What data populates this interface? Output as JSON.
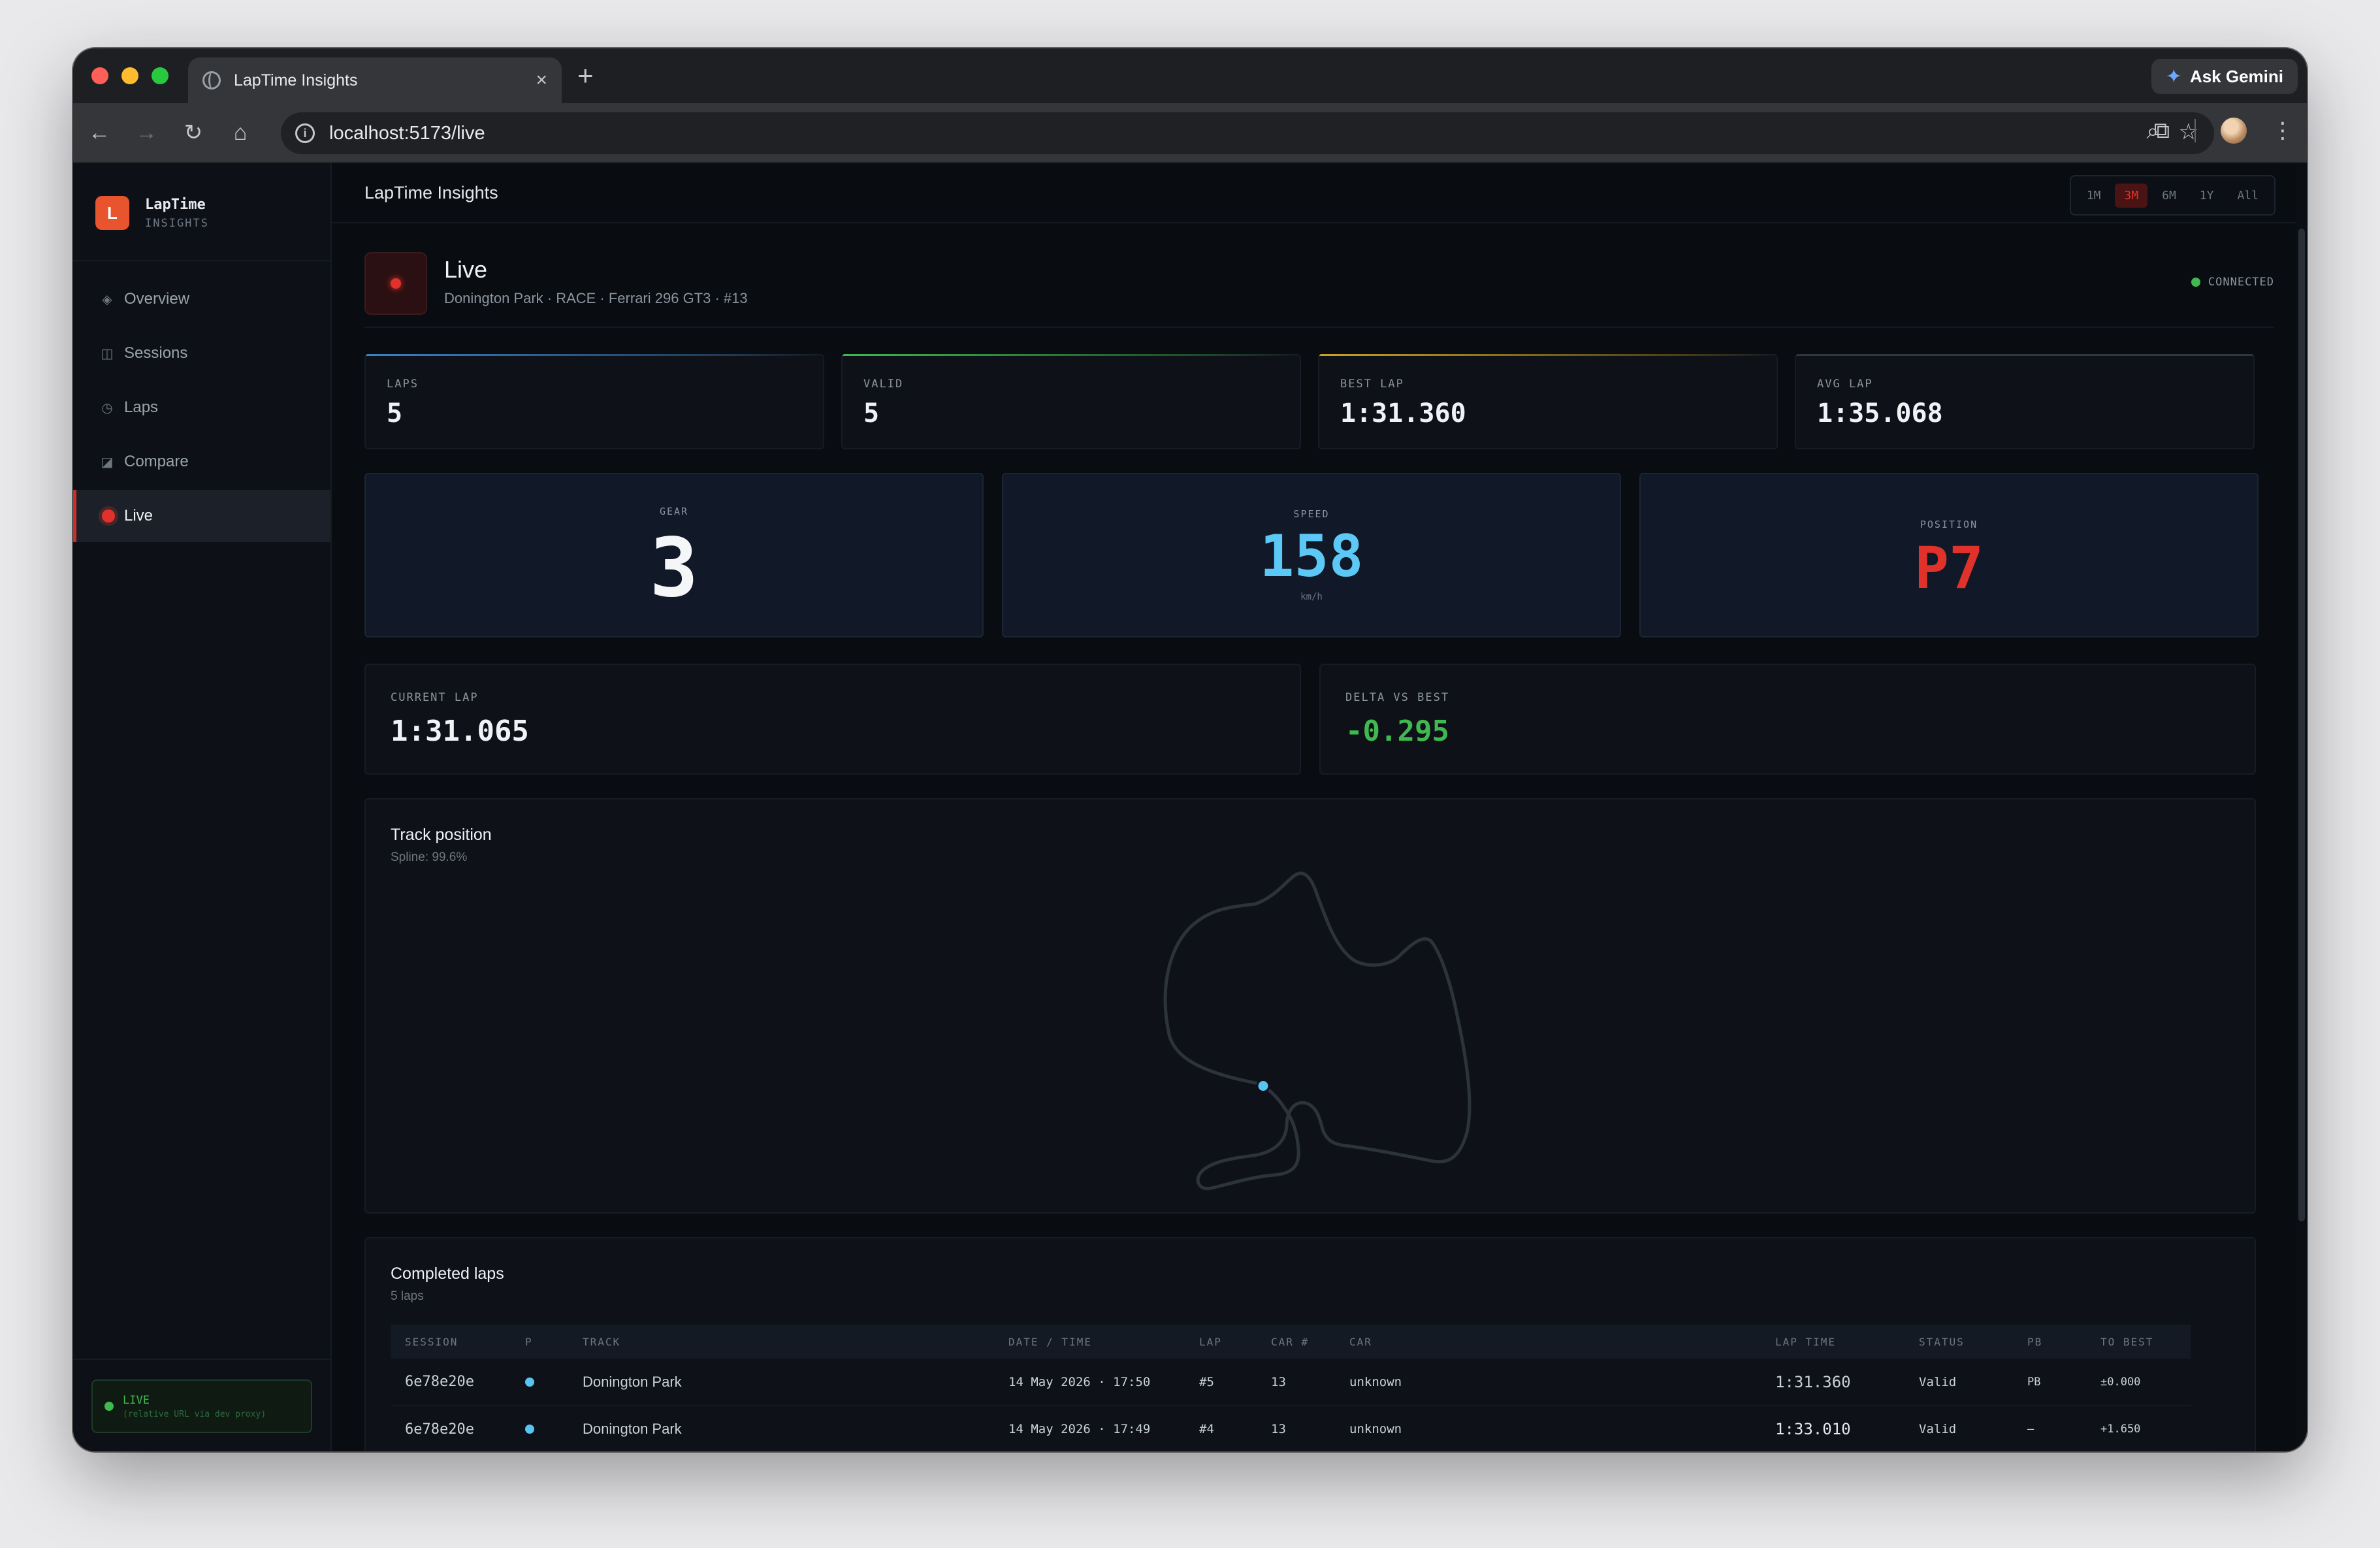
{
  "browser": {
    "tab_title": "LapTime Insights",
    "new_tab": "+",
    "ask_gemini": "Ask Gemini",
    "url": "localhost:5173/live"
  },
  "sidebar": {
    "brand_logo": "L",
    "brand_name": "LapTime",
    "brand_sub": "INSIGHTS",
    "items": [
      {
        "label": "Overview",
        "icon": "diamond-icon"
      },
      {
        "label": "Sessions",
        "icon": "columns-icon"
      },
      {
        "label": "Laps",
        "icon": "clock-icon"
      },
      {
        "label": "Compare",
        "icon": "chart-icon"
      },
      {
        "label": "Live",
        "icon": "live-dot-icon"
      }
    ],
    "live_status": "LIVE",
    "live_note": "(relative URL via dev proxy)"
  },
  "topbar": {
    "title": "LapTime Insights",
    "ranges": [
      "1M",
      "3M",
      "6M",
      "1Y",
      "All"
    ],
    "active_range": "3M"
  },
  "header": {
    "title": "Live",
    "subtitle": "Donington Park · RACE · Ferrari 296 GT3 · #13",
    "connection": "CONNECTED"
  },
  "stats": [
    {
      "label": "LAPS",
      "value": "5",
      "accent": "#3b82c4"
    },
    {
      "label": "VALID",
      "value": "5",
      "accent": "#3fb950"
    },
    {
      "label": "BEST LAP",
      "value": "1:31.360",
      "accent": "#c9a227"
    },
    {
      "label": "AVG LAP",
      "value": "1:35.068",
      "accent": "#30363d"
    }
  ],
  "telemetry": {
    "gear_label": "GEAR",
    "gear": "3",
    "speed_label": "SPEED",
    "speed": "158",
    "speed_unit": "km/h",
    "position_label": "POSITION",
    "position": "P7"
  },
  "timing": {
    "current_lap_label": "CURRENT LAP",
    "current_lap": "1:31.065",
    "delta_label": "DELTA VS BEST",
    "delta": "-0.295"
  },
  "track": {
    "title": "Track position",
    "spline": "Spline: 99.6%",
    "spline_fraction": 0.996
  },
  "laps_table": {
    "title": "Completed laps",
    "count": "5 laps",
    "columns": [
      "SESSION",
      "P",
      "TRACK",
      "DATE / TIME",
      "LAP",
      "CAR #",
      "CAR",
      "LAP TIME",
      "STATUS",
      "PB",
      "TO BEST"
    ],
    "rows": [
      {
        "session": "6e78e20e",
        "track": "Donington Park",
        "datetime": "14 May 2026 · 17:50",
        "lap": "#5",
        "car_no": "13",
        "car": "unknown",
        "lap_time": "1:31.360",
        "status": "Valid",
        "pb": "PB",
        "to_best": "±0.000"
      },
      {
        "session": "6e78e20e",
        "track": "Donington Park",
        "datetime": "14 May 2026 · 17:49",
        "lap": "#4",
        "car_no": "13",
        "car": "unknown",
        "lap_time": "1:33.010",
        "status": "Valid",
        "pb": "—",
        "to_best": "+1.650"
      }
    ]
  }
}
